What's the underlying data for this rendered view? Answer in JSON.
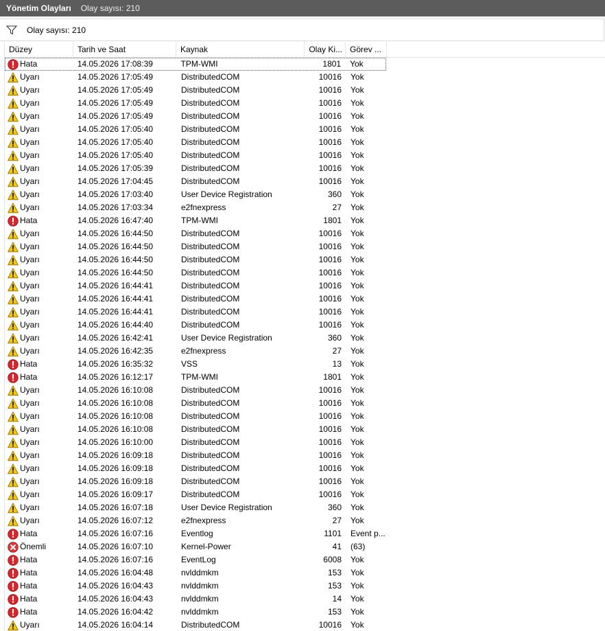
{
  "header": {
    "title": "Yönetim Olayları",
    "count_text": "Olay sayısı: 210"
  },
  "filterbar": {
    "count_text": "Olay sayısı: 210"
  },
  "columns": [
    "Düzey",
    "Tarih ve Saat",
    "Kaynak",
    "Olay Ki...",
    "Görev ..."
  ],
  "icons": {
    "Hata": "error-icon",
    "Uyarı": "warning-icon",
    "Önemli": "critical-icon"
  },
  "colors": {
    "error": "#d9262c",
    "warning": "#f5c518",
    "critical": "#e0373b",
    "titlebar": "#5c5c5c"
  },
  "rows": [
    [
      "Hata",
      "14.05.2026 17:08:39",
      "TPM-WMI",
      "1801",
      "Yok"
    ],
    [
      "Uyarı",
      "14.05.2026 17:05:49",
      "DistributedCOM",
      "10016",
      "Yok"
    ],
    [
      "Uyarı",
      "14.05.2026 17:05:49",
      "DistributedCOM",
      "10016",
      "Yok"
    ],
    [
      "Uyarı",
      "14.05.2026 17:05:49",
      "DistributedCOM",
      "10016",
      "Yok"
    ],
    [
      "Uyarı",
      "14.05.2026 17:05:49",
      "DistributedCOM",
      "10016",
      "Yok"
    ],
    [
      "Uyarı",
      "14.05.2026 17:05:40",
      "DistributedCOM",
      "10016",
      "Yok"
    ],
    [
      "Uyarı",
      "14.05.2026 17:05:40",
      "DistributedCOM",
      "10016",
      "Yok"
    ],
    [
      "Uyarı",
      "14.05.2026 17:05:40",
      "DistributedCOM",
      "10016",
      "Yok"
    ],
    [
      "Uyarı",
      "14.05.2026 17:05:39",
      "DistributedCOM",
      "10016",
      "Yok"
    ],
    [
      "Uyarı",
      "14.05.2026 17:04:45",
      "DistributedCOM",
      "10016",
      "Yok"
    ],
    [
      "Uyarı",
      "14.05.2026 17:03:40",
      "User Device Registration",
      "360",
      "Yok"
    ],
    [
      "Uyarı",
      "14.05.2026 17:03:34",
      "e2fnexpress",
      "27",
      "Yok"
    ],
    [
      "Hata",
      "14.05.2026 16:47:40",
      "TPM-WMI",
      "1801",
      "Yok"
    ],
    [
      "Uyarı",
      "14.05.2026 16:44:50",
      "DistributedCOM",
      "10016",
      "Yok"
    ],
    [
      "Uyarı",
      "14.05.2026 16:44:50",
      "DistributedCOM",
      "10016",
      "Yok"
    ],
    [
      "Uyarı",
      "14.05.2026 16:44:50",
      "DistributedCOM",
      "10016",
      "Yok"
    ],
    [
      "Uyarı",
      "14.05.2026 16:44:50",
      "DistributedCOM",
      "10016",
      "Yok"
    ],
    [
      "Uyarı",
      "14.05.2026 16:44:41",
      "DistributedCOM",
      "10016",
      "Yok"
    ],
    [
      "Uyarı",
      "14.05.2026 16:44:41",
      "DistributedCOM",
      "10016",
      "Yok"
    ],
    [
      "Uyarı",
      "14.05.2026 16:44:41",
      "DistributedCOM",
      "10016",
      "Yok"
    ],
    [
      "Uyarı",
      "14.05.2026 16:44:40",
      "DistributedCOM",
      "10016",
      "Yok"
    ],
    [
      "Uyarı",
      "14.05.2026 16:42:41",
      "User Device Registration",
      "360",
      "Yok"
    ],
    [
      "Uyarı",
      "14.05.2026 16:42:35",
      "e2fnexpress",
      "27",
      "Yok"
    ],
    [
      "Hata",
      "14.05.2026 16:35:32",
      "VSS",
      "13",
      "Yok"
    ],
    [
      "Hata",
      "14.05.2026 16:12:17",
      "TPM-WMI",
      "1801",
      "Yok"
    ],
    [
      "Uyarı",
      "14.05.2026 16:10:08",
      "DistributedCOM",
      "10016",
      "Yok"
    ],
    [
      "Uyarı",
      "14.05.2026 16:10:08",
      "DistributedCOM",
      "10016",
      "Yok"
    ],
    [
      "Uyarı",
      "14.05.2026 16:10:08",
      "DistributedCOM",
      "10016",
      "Yok"
    ],
    [
      "Uyarı",
      "14.05.2026 16:10:08",
      "DistributedCOM",
      "10016",
      "Yok"
    ],
    [
      "Uyarı",
      "14.05.2026 16:10:00",
      "DistributedCOM",
      "10016",
      "Yok"
    ],
    [
      "Uyarı",
      "14.05.2026 16:09:18",
      "DistributedCOM",
      "10016",
      "Yok"
    ],
    [
      "Uyarı",
      "14.05.2026 16:09:18",
      "DistributedCOM",
      "10016",
      "Yok"
    ],
    [
      "Uyarı",
      "14.05.2026 16:09:18",
      "DistributedCOM",
      "10016",
      "Yok"
    ],
    [
      "Uyarı",
      "14.05.2026 16:09:17",
      "DistributedCOM",
      "10016",
      "Yok"
    ],
    [
      "Uyarı",
      "14.05.2026 16:07:18",
      "User Device Registration",
      "360",
      "Yok"
    ],
    [
      "Uyarı",
      "14.05.2026 16:07:12",
      "e2fnexpress",
      "27",
      "Yok"
    ],
    [
      "Hata",
      "14.05.2026 16:07:16",
      "Eventlog",
      "1101",
      "Event p..."
    ],
    [
      "Önemli",
      "14.05.2026 16:07:10",
      "Kernel-Power",
      "41",
      "(63)"
    ],
    [
      "Hata",
      "14.05.2026 16:07:16",
      "EventLog",
      "6008",
      "Yok"
    ],
    [
      "Hata",
      "14.05.2026 16:04:48",
      "nvlddmkm",
      "153",
      "Yok"
    ],
    [
      "Hata",
      "14.05.2026 16:04:43",
      "nvlddmkm",
      "153",
      "Yok"
    ],
    [
      "Hata",
      "14.05.2026 16:04:43",
      "nvlddmkm",
      "14",
      "Yok"
    ],
    [
      "Hata",
      "14.05.2026 16:04:42",
      "nvlddmkm",
      "153",
      "Yok"
    ],
    [
      "Uyarı",
      "14.05.2026 16:04:14",
      "DistributedCOM",
      "10016",
      "Yok"
    ]
  ]
}
